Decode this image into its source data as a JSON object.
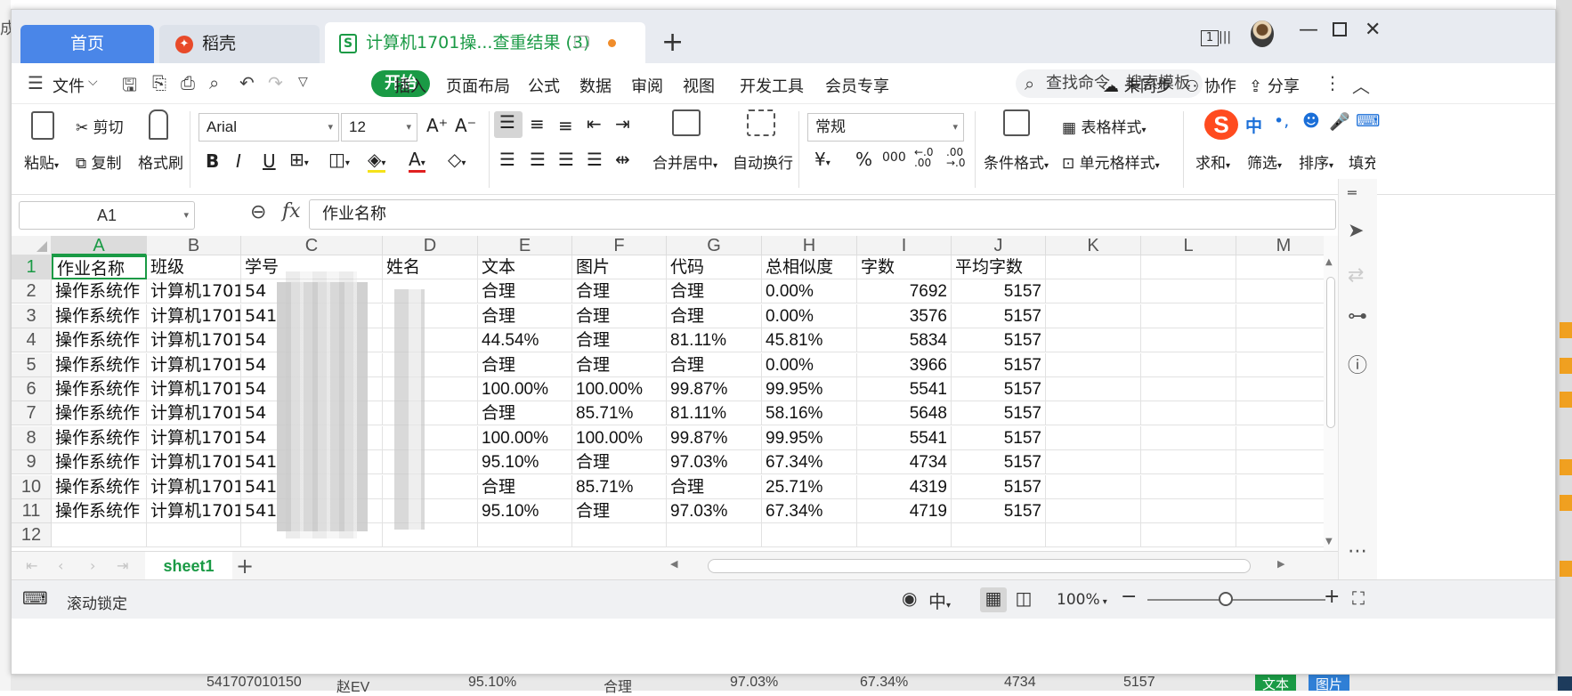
{
  "window": {
    "tabs": [
      {
        "label": "首页"
      },
      {
        "label": "稻壳"
      },
      {
        "label": "计算机1701操...查重结果 (3)"
      }
    ],
    "page_badge": "1"
  },
  "menu": {
    "file": "文件",
    "items": [
      "开始",
      "插入",
      "页面布局",
      "公式",
      "数据",
      "审阅",
      "视图",
      "开发工具",
      "会员专享"
    ],
    "search_placeholder": "查找命令、搜索模板",
    "sync": "未同步",
    "collab": "协作",
    "share": "分享"
  },
  "ribbon": {
    "paste": "粘贴",
    "cut": "剪切",
    "copy": "复制",
    "format_painter": "格式刷",
    "font_name": "Arial",
    "font_size": "12",
    "merge_center": "合并居中",
    "auto_wrap": "自动换行",
    "number_format": "常规",
    "currency": "¥",
    "percent": "%",
    "thousands": "000",
    "cond_format": "条件格式",
    "table_style": "表格样式",
    "cell_style": "单元格样式",
    "sum": "求和",
    "filter": "筛选",
    "sort": "排序",
    "fill": "填充"
  },
  "ime": {
    "mode": "中"
  },
  "formula_bar": {
    "name_box": "A1",
    "fx": "fx",
    "content": "作业名称"
  },
  "sheet": {
    "columns": [
      "A",
      "B",
      "C",
      "D",
      "E",
      "F",
      "G",
      "H",
      "I",
      "J",
      "K",
      "L",
      "M"
    ],
    "rows": [
      "1",
      "2",
      "3",
      "4",
      "5",
      "6",
      "7",
      "8",
      "9",
      "10",
      "11",
      "12"
    ],
    "header_row": [
      "作业名称",
      "班级",
      "学号",
      "姓名",
      "文本",
      "图片",
      "代码",
      "总相似度",
      "字数",
      "平均字数"
    ],
    "data": [
      [
        "操作系统作",
        "计算机1701",
        "54",
        "",
        "合理",
        "合理",
        "合理",
        "0.00%",
        "7692",
        "5157"
      ],
      [
        "操作系统作",
        "计算机1701",
        "541",
        "",
        "合理",
        "合理",
        "合理",
        "0.00%",
        "3576",
        "5157"
      ],
      [
        "操作系统作",
        "计算机1701",
        "54",
        "",
        "44.54%",
        "合理",
        "81.11%",
        "45.81%",
        "5834",
        "5157"
      ],
      [
        "操作系统作",
        "计算机1701",
        "54",
        "",
        "合理",
        "合理",
        "合理",
        "0.00%",
        "3966",
        "5157"
      ],
      [
        "操作系统作",
        "计算机1701",
        "54",
        "",
        "100.00%",
        "100.00%",
        "99.87%",
        "99.95%",
        "5541",
        "5157"
      ],
      [
        "操作系统作",
        "计算机1701",
        "54",
        "",
        "合理",
        "85.71%",
        "81.11%",
        "58.16%",
        "5648",
        "5157"
      ],
      [
        "操作系统作",
        "计算机1701",
        "54",
        "",
        "100.00%",
        "100.00%",
        "99.87%",
        "99.95%",
        "5541",
        "5157"
      ],
      [
        "操作系统作",
        "计算机1701",
        "541",
        "",
        "95.10%",
        "合理",
        "97.03%",
        "67.34%",
        "4734",
        "5157"
      ],
      [
        "操作系统作",
        "计算机1701",
        "541",
        "",
        "合理",
        "85.71%",
        "合理",
        "25.71%",
        "4319",
        "5157"
      ],
      [
        "操作系统作",
        "计算机1701",
        "541",
        "",
        "95.10%",
        "合理",
        "97.03%",
        "67.34%",
        "4719",
        "5157"
      ]
    ],
    "tab": "sheet1"
  },
  "status": {
    "scroll_lock": "滚动锁定",
    "zoom": "100%"
  },
  "behind": {
    "row": [
      "541707010150",
      "赵EV",
      "95.10%",
      "合理",
      "97.03%",
      "67.34%",
      "4734",
      "5157"
    ],
    "tag1": "文本",
    "tag2": "图片",
    "left_char": "成"
  },
  "colors": {
    "accent": "#1a9a45",
    "home_tab": "#4a86e8",
    "ime_logo": "#ff4b1f"
  }
}
